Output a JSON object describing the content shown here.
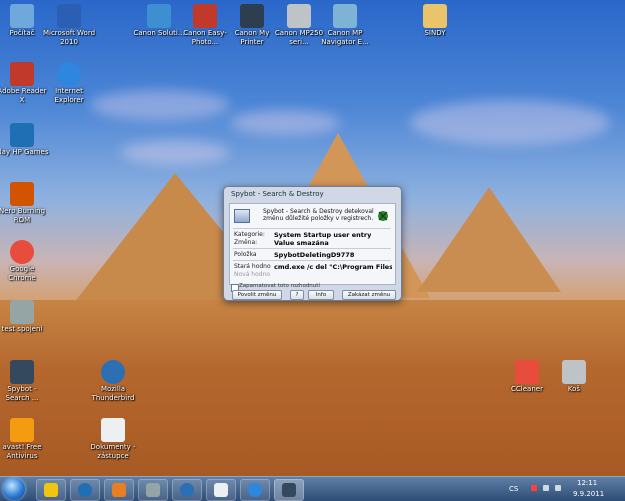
{
  "desktop": {
    "icons": [
      {
        "id": "pocitac",
        "label": "Počítač",
        "color": "#6fa8dc"
      },
      {
        "id": "word",
        "label": "Microsoft Word 2010",
        "color": "#2b5fb3"
      },
      {
        "id": "canon-solution",
        "label": "Canon Soluti...",
        "color": "#3d8fd1"
      },
      {
        "id": "canon-easy-photo",
        "label": "Canon Easy-Photo...",
        "color": "#c0392b"
      },
      {
        "id": "canon-my-printer",
        "label": "Canon My Printer",
        "color": "#2c3e50"
      },
      {
        "id": "canon-mp250",
        "label": "Canon MP250 seri...",
        "color": "#bdc3c7"
      },
      {
        "id": "canon-navigator",
        "label": "Canon MP Navigator E...",
        "color": "#7fb3d5"
      },
      {
        "id": "sindy",
        "label": "SINDY",
        "color": "#e9c46a"
      },
      {
        "id": "adobe-reader",
        "label": "Adobe Reader X",
        "color": "#c0392b"
      },
      {
        "id": "ie",
        "label": "Internet Explorer",
        "color": "#2e86de"
      },
      {
        "id": "play-hp",
        "label": "Play HP Games",
        "color": "#1f6fb5"
      },
      {
        "id": "nero",
        "label": "Nero Burning ROM",
        "color": "#d35400"
      },
      {
        "id": "chrome",
        "label": "Google Chrome",
        "color": "#e74c3c"
      },
      {
        "id": "test-spojeni",
        "label": "test spojení",
        "color": "#95a5a6"
      },
      {
        "id": "spybot",
        "label": "Spybot - Search ...",
        "color": "#34495e"
      },
      {
        "id": "thunderbird",
        "label": "Mozilla Thunderbird",
        "color": "#2c6fb5"
      },
      {
        "id": "ccleaner",
        "label": "CCleaner",
        "color": "#e74c3c"
      },
      {
        "id": "kos",
        "label": "Koš",
        "color": "#bdc3c7"
      },
      {
        "id": "avast",
        "label": "avast! Free Antivirus",
        "color": "#f39c12"
      },
      {
        "id": "dokumenty",
        "label": "Dokumenty - zástupce",
        "color": "#ecf0f1"
      }
    ]
  },
  "dialog": {
    "title": "Spybot - Search & Destroy",
    "message": "Spybot - Search & Destroy detekoval změnu důležité položky v registrech.",
    "kategorie_label": "Kategorie:",
    "kategorie_value": "System Startup user entry",
    "zmena_label": "Změna:",
    "zmena_value": "Value smazána",
    "polozka_label": "Položka",
    "polozka_value": "SpybotDeletingD9778",
    "stara_label": "Stará hodno",
    "stara_value": "cmd.exe /c del \"C:\\Program Files (x8",
    "nova_label": "Nová hodno",
    "nova_value": "",
    "checkbox_label": "Zapamatovat toto rozhodnutí",
    "btn_allow": "Povolit změnu",
    "btn_help": "?",
    "btn_info": "Info",
    "btn_deny": "Zakázat změnu"
  },
  "taskbar": {
    "pinned": [
      {
        "id": "explorer",
        "color": "#f1c40f"
      },
      {
        "id": "hp",
        "color": "#1f6fb5"
      },
      {
        "id": "media",
        "color": "#e67e22"
      },
      {
        "id": "photo",
        "color": "#95a5a6"
      },
      {
        "id": "thunderbird",
        "color": "#2c6fb5"
      },
      {
        "id": "calc",
        "color": "#ecf0f1"
      },
      {
        "id": "ie",
        "color": "#2e86de"
      },
      {
        "id": "spybot",
        "color": "#34495e"
      }
    ],
    "lang": "CS",
    "time": "12:11",
    "date": "9.9.2011"
  }
}
